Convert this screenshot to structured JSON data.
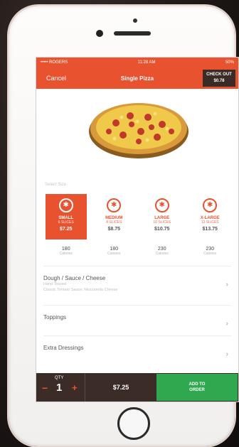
{
  "status": {
    "carrier": "••••• ROGERS",
    "time": "11:28 AM",
    "battery": "50%"
  },
  "nav": {
    "cancel": "Cancel",
    "title": "Single Pizza",
    "checkout_label": "CHECK OUT",
    "checkout_amount": "$0.78"
  },
  "section_label": "Select Size",
  "sizes": [
    {
      "name": "SMALL",
      "slices": "6 SLICES",
      "price": "$7.25",
      "cal": "180",
      "cal_unit": "Calories"
    },
    {
      "name": "MEDIUM",
      "slices": "8 SLICES",
      "price": "$8.75",
      "cal": "180",
      "cal_unit": "Calories"
    },
    {
      "name": "LARGE",
      "slices": "10 SLICES",
      "price": "$10.75",
      "cal": "230",
      "cal_unit": "Calories"
    },
    {
      "name": "X-LARGE",
      "slices": "12 SLICES",
      "price": "$13.75",
      "cal": "230",
      "cal_unit": "Calories"
    }
  ],
  "rows": [
    {
      "title": "Dough / Sauce / Cheese",
      "sub1": "Hand Tossed",
      "sub2": "Classic Tomato Sauce, Mozzarella Cheese"
    },
    {
      "title": "Toppings",
      "sub1": "",
      "sub2": ""
    },
    {
      "title": "Extra Dressings",
      "sub1": "",
      "sub2": ""
    }
  ],
  "bottom": {
    "qty_label": "QTY",
    "qty": "1",
    "minus": "−",
    "plus": "+",
    "total": "$7.25",
    "add_line1": "ADD TO",
    "add_line2": "ORDER"
  },
  "colors": {
    "accent": "#e8522e",
    "dark": "#3b2c28",
    "green": "#2fa84f"
  }
}
